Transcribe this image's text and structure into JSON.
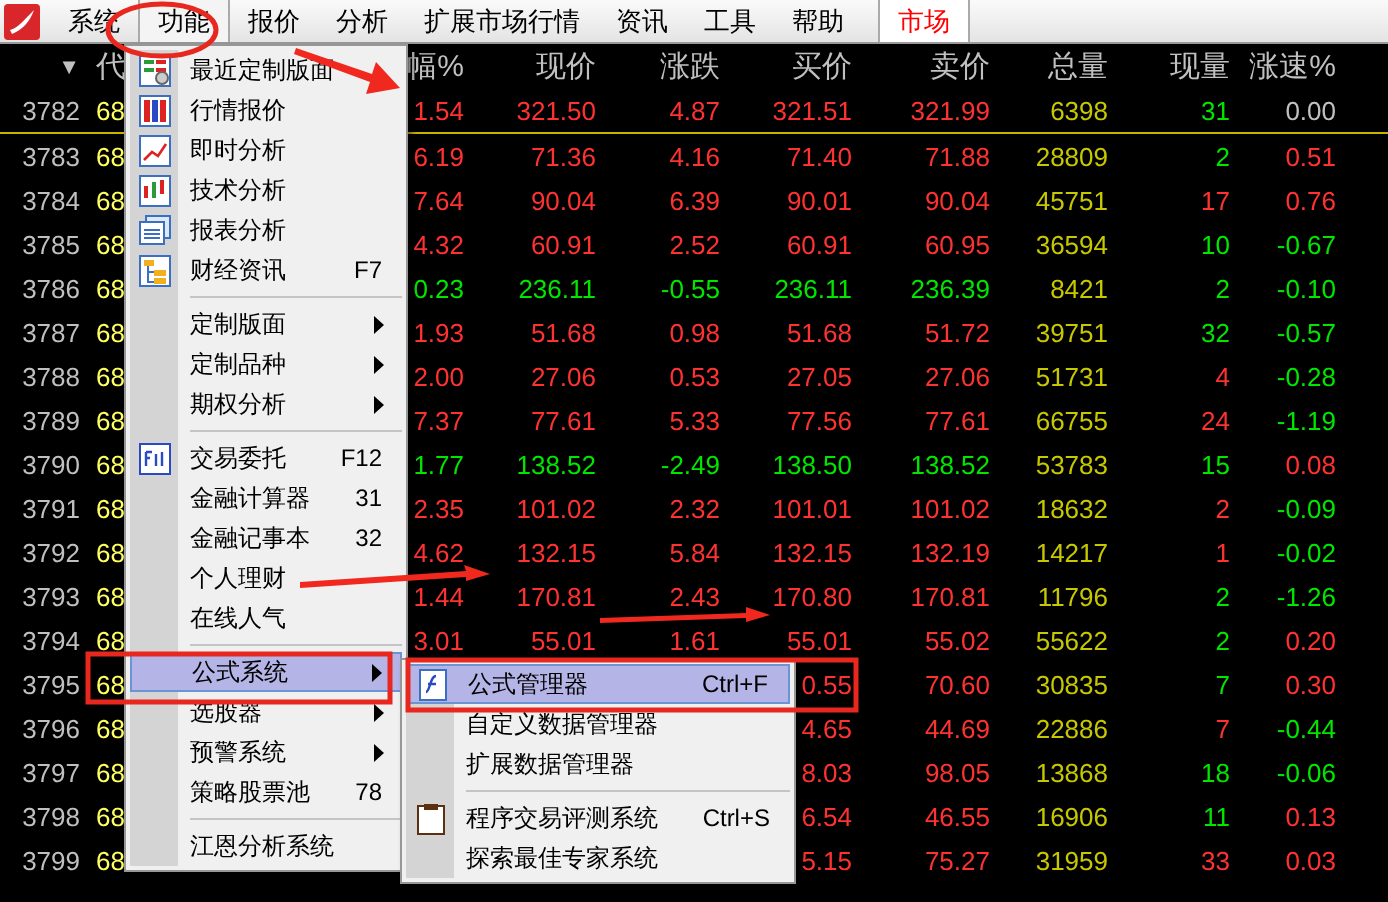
{
  "menubar": {
    "items": [
      {
        "label": "系统",
        "selected": false
      },
      {
        "label": "功能",
        "selected": true
      },
      {
        "label": "报价",
        "selected": false
      },
      {
        "label": "分析",
        "selected": false
      },
      {
        "label": "扩展市场行情",
        "selected": false
      },
      {
        "label": "资讯",
        "selected": false
      },
      {
        "label": "工具",
        "selected": false
      },
      {
        "label": "帮助",
        "selected": false
      }
    ],
    "market_tab": {
      "label": "市场"
    }
  },
  "table": {
    "columns": [
      "▼",
      "代",
      "幅%",
      "现价",
      "涨跌",
      "买价",
      "卖价",
      "总量",
      "现量",
      "涨速%"
    ],
    "rows": [
      {
        "selected": true,
        "cells": [
          {
            "text": "3782"
          },
          {
            "text": "68"
          },
          {
            "text": "1.54",
            "color": "#ff3232"
          },
          {
            "text": "321.50",
            "color": "#ff3232"
          },
          {
            "text": "4.87",
            "color": "#ff3232"
          },
          {
            "text": "321.51",
            "color": "#ff3232"
          },
          {
            "text": "321.99",
            "color": "#ff3232"
          },
          {
            "text": "6398",
            "color": "#c8c800"
          },
          {
            "text": "31",
            "color": "#00e600"
          },
          {
            "text": "0.00",
            "color": "#c0c0c0"
          }
        ]
      },
      {
        "selected": false,
        "cells": [
          {
            "text": "3783"
          },
          {
            "text": "68"
          },
          {
            "text": "6.19",
            "color": "#ff3232"
          },
          {
            "text": "71.36",
            "color": "#ff3232"
          },
          {
            "text": "4.16",
            "color": "#ff3232"
          },
          {
            "text": "71.40",
            "color": "#ff3232"
          },
          {
            "text": "71.88",
            "color": "#ff3232"
          },
          {
            "text": "28809",
            "color": "#c8c800"
          },
          {
            "text": "2",
            "color": "#00e600"
          },
          {
            "text": "0.51",
            "color": "#ff3232"
          }
        ]
      },
      {
        "selected": false,
        "cells": [
          {
            "text": "3784"
          },
          {
            "text": "68"
          },
          {
            "text": "7.64",
            "color": "#ff3232"
          },
          {
            "text": "90.04",
            "color": "#ff3232"
          },
          {
            "text": "6.39",
            "color": "#ff3232"
          },
          {
            "text": "90.01",
            "color": "#ff3232"
          },
          {
            "text": "90.04",
            "color": "#ff3232"
          },
          {
            "text": "45751",
            "color": "#c8c800"
          },
          {
            "text": "17",
            "color": "#ff3232"
          },
          {
            "text": "0.76",
            "color": "#ff3232"
          }
        ]
      },
      {
        "selected": false,
        "cells": [
          {
            "text": "3785"
          },
          {
            "text": "68"
          },
          {
            "text": "4.32",
            "color": "#ff3232"
          },
          {
            "text": "60.91",
            "color": "#ff3232"
          },
          {
            "text": "2.52",
            "color": "#ff3232"
          },
          {
            "text": "60.91",
            "color": "#ff3232"
          },
          {
            "text": "60.95",
            "color": "#ff3232"
          },
          {
            "text": "36594",
            "color": "#c8c800"
          },
          {
            "text": "10",
            "color": "#00e600"
          },
          {
            "text": "-0.67",
            "color": "#00e600"
          }
        ]
      },
      {
        "selected": false,
        "cells": [
          {
            "text": "3786"
          },
          {
            "text": "68"
          },
          {
            "text": "0.23",
            "color": "#00e600"
          },
          {
            "text": "236.11",
            "color": "#00e600"
          },
          {
            "text": "-0.55",
            "color": "#00e600"
          },
          {
            "text": "236.11",
            "color": "#00e600"
          },
          {
            "text": "236.39",
            "color": "#00e600"
          },
          {
            "text": "8421",
            "color": "#c8c800"
          },
          {
            "text": "2",
            "color": "#00e600"
          },
          {
            "text": "-0.10",
            "color": "#00e600"
          }
        ]
      },
      {
        "selected": false,
        "cells": [
          {
            "text": "3787"
          },
          {
            "text": "68"
          },
          {
            "text": "1.93",
            "color": "#ff3232"
          },
          {
            "text": "51.68",
            "color": "#ff3232"
          },
          {
            "text": "0.98",
            "color": "#ff3232"
          },
          {
            "text": "51.68",
            "color": "#ff3232"
          },
          {
            "text": "51.72",
            "color": "#ff3232"
          },
          {
            "text": "39751",
            "color": "#c8c800"
          },
          {
            "text": "32",
            "color": "#00e600"
          },
          {
            "text": "-0.57",
            "color": "#00e600"
          }
        ]
      },
      {
        "selected": false,
        "cells": [
          {
            "text": "3788"
          },
          {
            "text": "68"
          },
          {
            "text": "2.00",
            "color": "#ff3232"
          },
          {
            "text": "27.06",
            "color": "#ff3232"
          },
          {
            "text": "0.53",
            "color": "#ff3232"
          },
          {
            "text": "27.05",
            "color": "#ff3232"
          },
          {
            "text": "27.06",
            "color": "#ff3232"
          },
          {
            "text": "51731",
            "color": "#c8c800"
          },
          {
            "text": "4",
            "color": "#ff3232"
          },
          {
            "text": "-0.28",
            "color": "#00e600"
          }
        ]
      },
      {
        "selected": false,
        "cells": [
          {
            "text": "3789"
          },
          {
            "text": "68"
          },
          {
            "text": "7.37",
            "color": "#ff3232"
          },
          {
            "text": "77.61",
            "color": "#ff3232"
          },
          {
            "text": "5.33",
            "color": "#ff3232"
          },
          {
            "text": "77.56",
            "color": "#ff3232"
          },
          {
            "text": "77.61",
            "color": "#ff3232"
          },
          {
            "text": "66755",
            "color": "#c8c800"
          },
          {
            "text": "24",
            "color": "#ff3232"
          },
          {
            "text": "-1.19",
            "color": "#00e600"
          }
        ]
      },
      {
        "selected": false,
        "cells": [
          {
            "text": "3790"
          },
          {
            "text": "68"
          },
          {
            "text": "1.77",
            "color": "#00e600"
          },
          {
            "text": "138.52",
            "color": "#00e600"
          },
          {
            "text": "-2.49",
            "color": "#00e600"
          },
          {
            "text": "138.50",
            "color": "#00e600"
          },
          {
            "text": "138.52",
            "color": "#00e600"
          },
          {
            "text": "53783",
            "color": "#c8c800"
          },
          {
            "text": "15",
            "color": "#00e600"
          },
          {
            "text": "0.08",
            "color": "#ff3232"
          }
        ]
      },
      {
        "selected": false,
        "cells": [
          {
            "text": "3791"
          },
          {
            "text": "68"
          },
          {
            "text": "2.35",
            "color": "#ff3232"
          },
          {
            "text": "101.02",
            "color": "#ff3232"
          },
          {
            "text": "2.32",
            "color": "#ff3232"
          },
          {
            "text": "101.01",
            "color": "#ff3232"
          },
          {
            "text": "101.02",
            "color": "#ff3232"
          },
          {
            "text": "18632",
            "color": "#c8c800"
          },
          {
            "text": "2",
            "color": "#ff3232"
          },
          {
            "text": "-0.09",
            "color": "#00e600"
          }
        ]
      },
      {
        "selected": false,
        "cells": [
          {
            "text": "3792"
          },
          {
            "text": "68"
          },
          {
            "text": "4.62",
            "color": "#ff3232"
          },
          {
            "text": "132.15",
            "color": "#ff3232"
          },
          {
            "text": "5.84",
            "color": "#ff3232"
          },
          {
            "text": "132.15",
            "color": "#ff3232"
          },
          {
            "text": "132.19",
            "color": "#ff3232"
          },
          {
            "text": "14217",
            "color": "#c8c800"
          },
          {
            "text": "1",
            "color": "#ff3232"
          },
          {
            "text": "-0.02",
            "color": "#00e600"
          }
        ]
      },
      {
        "selected": false,
        "cells": [
          {
            "text": "3793"
          },
          {
            "text": "68"
          },
          {
            "text": "1.44",
            "color": "#ff3232"
          },
          {
            "text": "170.81",
            "color": "#ff3232"
          },
          {
            "text": "2.43",
            "color": "#ff3232"
          },
          {
            "text": "170.80",
            "color": "#ff3232"
          },
          {
            "text": "170.81",
            "color": "#ff3232"
          },
          {
            "text": "11796",
            "color": "#c8c800"
          },
          {
            "text": "2",
            "color": "#00e600"
          },
          {
            "text": "-1.26",
            "color": "#00e600"
          }
        ]
      },
      {
        "selected": false,
        "cells": [
          {
            "text": "3794"
          },
          {
            "text": "68"
          },
          {
            "text": "3.01",
            "color": "#ff3232"
          },
          {
            "text": "55.01",
            "color": "#ff3232"
          },
          {
            "text": "1.61",
            "color": "#ff3232"
          },
          {
            "text": "55.01",
            "color": "#ff3232"
          },
          {
            "text": "55.02",
            "color": "#ff3232"
          },
          {
            "text": "55622",
            "color": "#c8c800"
          },
          {
            "text": "2",
            "color": "#00e600"
          },
          {
            "text": "0.20",
            "color": "#ff3232"
          }
        ]
      },
      {
        "selected": false,
        "cells": [
          {
            "text": "3795"
          },
          {
            "text": "68"
          },
          {
            "text": ""
          },
          {
            "text": ""
          },
          {
            "text": ""
          },
          {
            "text": "0.55",
            "color": "#ff3232"
          },
          {
            "text": "70.60",
            "color": "#ff3232"
          },
          {
            "text": "30835",
            "color": "#c8c800"
          },
          {
            "text": "7",
            "color": "#00e600"
          },
          {
            "text": "0.30",
            "color": "#ff3232"
          }
        ]
      },
      {
        "selected": false,
        "cells": [
          {
            "text": "3796"
          },
          {
            "text": "68"
          },
          {
            "text": ""
          },
          {
            "text": ""
          },
          {
            "text": ""
          },
          {
            "text": "4.65",
            "color": "#ff3232"
          },
          {
            "text": "44.69",
            "color": "#ff3232"
          },
          {
            "text": "22886",
            "color": "#c8c800"
          },
          {
            "text": "7",
            "color": "#ff3232"
          },
          {
            "text": "-0.44",
            "color": "#00e600"
          }
        ]
      },
      {
        "selected": false,
        "cells": [
          {
            "text": "3797"
          },
          {
            "text": "68"
          },
          {
            "text": ""
          },
          {
            "text": ""
          },
          {
            "text": ""
          },
          {
            "text": "8.03",
            "color": "#ff3232"
          },
          {
            "text": "98.05",
            "color": "#ff3232"
          },
          {
            "text": "13868",
            "color": "#c8c800"
          },
          {
            "text": "18",
            "color": "#00e600"
          },
          {
            "text": "-0.06",
            "color": "#00e600"
          }
        ]
      },
      {
        "selected": false,
        "cells": [
          {
            "text": "3798"
          },
          {
            "text": "68"
          },
          {
            "text": ""
          },
          {
            "text": ""
          },
          {
            "text": ""
          },
          {
            "text": "6.54",
            "color": "#ff3232"
          },
          {
            "text": "46.55",
            "color": "#ff3232"
          },
          {
            "text": "16906",
            "color": "#c8c800"
          },
          {
            "text": "11",
            "color": "#00e600"
          },
          {
            "text": "0.13",
            "color": "#ff3232"
          }
        ]
      },
      {
        "selected": false,
        "cells": [
          {
            "text": "3799"
          },
          {
            "text": "68"
          },
          {
            "text": ""
          },
          {
            "text": ""
          },
          {
            "text": ""
          },
          {
            "text": "5.15",
            "color": "#ff3232"
          },
          {
            "text": "75.27",
            "color": "#ff3232"
          },
          {
            "text": "31959",
            "color": "#c8c800"
          },
          {
            "text": "33",
            "color": "#ff3232"
          },
          {
            "text": "0.03",
            "color": "#ff3232"
          }
        ]
      }
    ]
  },
  "menu": {
    "items": [
      {
        "kind": "item",
        "label": "最近定制版面",
        "icon": true,
        "selected": false
      },
      {
        "kind": "item",
        "label": "行情报价",
        "icon": true,
        "selected": false
      },
      {
        "kind": "item",
        "label": "即时分析",
        "icon": true,
        "selected": false
      },
      {
        "kind": "item",
        "label": "技术分析",
        "icon": true,
        "selected": false
      },
      {
        "kind": "item",
        "label": "报表分析",
        "icon": true,
        "selected": false
      },
      {
        "kind": "item",
        "label": "财经资讯",
        "shortcut": "F7",
        "icon": true,
        "selected": false
      },
      {
        "kind": "separator"
      },
      {
        "kind": "item",
        "label": "定制版面",
        "submenu": true,
        "selected": false
      },
      {
        "kind": "item",
        "label": "定制品种",
        "submenu": true,
        "selected": false
      },
      {
        "kind": "item",
        "label": "期权分析",
        "submenu": true,
        "selected": false
      },
      {
        "kind": "separator"
      },
      {
        "kind": "item",
        "label": "交易委托",
        "shortcut": "F12",
        "icon": true,
        "selected": false
      },
      {
        "kind": "item",
        "label": "金融计算器",
        "shortcut": "31",
        "selected": false
      },
      {
        "kind": "item",
        "label": "金融记事本",
        "shortcut": "32",
        "selected": false
      },
      {
        "kind": "item",
        "label": "个人理财",
        "selected": false
      },
      {
        "kind": "item",
        "label": "在线人气",
        "selected": false
      },
      {
        "kind": "separator"
      },
      {
        "kind": "item",
        "label": "公式系统",
        "submenu": true,
        "selected": true
      },
      {
        "kind": "item",
        "label": "选股器",
        "submenu": true,
        "selected": false
      },
      {
        "kind": "item",
        "label": "预警系统",
        "submenu": true,
        "selected": false
      },
      {
        "kind": "item",
        "label": "策略股票池",
        "shortcut": "78",
        "selected": false
      },
      {
        "kind": "separator"
      },
      {
        "kind": "item",
        "label": "江恩分析系统",
        "selected": false
      }
    ]
  },
  "submenu": {
    "items": [
      {
        "kind": "item",
        "label": "公式管理器",
        "shortcut": "Ctrl+F",
        "icon": true,
        "selected": true
      },
      {
        "kind": "item",
        "label": "自定义数据管理器",
        "selected": false
      },
      {
        "kind": "item",
        "label": "扩展数据管理器",
        "selected": false
      },
      {
        "kind": "separator"
      },
      {
        "kind": "item",
        "label": "程序交易评测系统",
        "shortcut": "Ctrl+S",
        "icon": true,
        "selected": false
      },
      {
        "kind": "item",
        "label": "探索最佳专家系统",
        "selected": false
      }
    ]
  },
  "annotations": [
    {
      "kind": "ellipse"
    },
    {
      "kind": "arrow"
    },
    {
      "kind": "arrow"
    },
    {
      "kind": "arrow"
    },
    {
      "kind": "box"
    },
    {
      "kind": "box"
    }
  ]
}
